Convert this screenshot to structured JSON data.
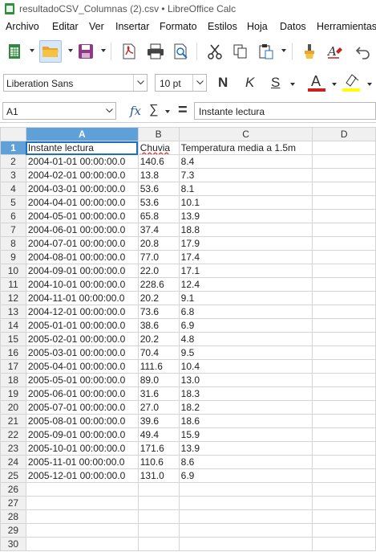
{
  "window": {
    "title": "resultadoCSV_Columnas (2).csv • LibreOffice Calc"
  },
  "menu": [
    "Archivo",
    "Editar",
    "Ver",
    "Insertar",
    "Formato",
    "Estilos",
    "Hoja",
    "Datos",
    "Herramientas"
  ],
  "toolbar": {
    "icons": [
      "new-spreadsheet-icon",
      "open-folder-icon",
      "save-icon",
      "export-pdf-icon",
      "print-icon",
      "print-preview-icon",
      "cut-icon",
      "copy-icon",
      "paste-icon",
      "clone-formatting-icon",
      "clear-formatting-icon",
      "undo-icon"
    ]
  },
  "format": {
    "font_name": "Liberation Sans",
    "font_size": "10 pt",
    "bold": "N",
    "italic": "K",
    "underline": "S",
    "font_color_label": "A",
    "font_color": "#c9211e",
    "highlight_color": "#ffff00"
  },
  "formula_bar": {
    "name_box": "A1",
    "content": "Instante lectura"
  },
  "columns": [
    "A",
    "B",
    "C",
    "D"
  ],
  "row_numbers": [
    "1",
    "2",
    "3",
    "4",
    "5",
    "6",
    "7",
    "8",
    "9",
    "10",
    "11",
    "12",
    "13",
    "14",
    "15",
    "16",
    "17",
    "18",
    "19",
    "20",
    "21",
    "22",
    "23",
    "24",
    "25",
    "26",
    "27",
    "28",
    "29",
    "30"
  ],
  "cells": [
    [
      "Instante lectura",
      "Chuvia",
      "Temperatura media a 1.5m"
    ],
    [
      "2004-01-01 00:00:00.0",
      "140.6",
      "8.4"
    ],
    [
      "2004-02-01 00:00:00.0",
      "13.8",
      "7.3"
    ],
    [
      "2004-03-01 00:00:00.0",
      "53.6",
      "8.1"
    ],
    [
      "2004-04-01 00:00:00.0",
      "53.6",
      "10.1"
    ],
    [
      "2004-05-01 00:00:00.0",
      "65.8",
      "13.9"
    ],
    [
      "2004-06-01 00:00:00.0",
      "37.4",
      "18.8"
    ],
    [
      "2004-07-01 00:00:00.0",
      "20.8",
      "17.9"
    ],
    [
      "2004-08-01 00:00:00.0",
      "77.0",
      "17.4"
    ],
    [
      "2004-09-01 00:00:00.0",
      "22.0",
      "17.1"
    ],
    [
      "2004-10-01 00:00:00.0",
      "228.6",
      "12.4"
    ],
    [
      "2004-11-01 00:00:00.0",
      "20.2",
      "9.1"
    ],
    [
      "2004-12-01 00:00:00.0",
      "73.6",
      "6.8"
    ],
    [
      "2005-01-01 00:00:00.0",
      "38.6",
      "6.9"
    ],
    [
      "2005-02-01 00:00:00.0",
      "20.2",
      "4.8"
    ],
    [
      "2005-03-01 00:00:00.0",
      "70.4",
      "9.5"
    ],
    [
      "2005-04-01 00:00:00.0",
      "111.6",
      "10.4"
    ],
    [
      "2005-05-01 00:00:00.0",
      "89.0",
      "13.0"
    ],
    [
      "2005-06-01 00:00:00.0",
      "31.6",
      "18.3"
    ],
    [
      "2005-07-01 00:00:00.0",
      "27.0",
      "18.2"
    ],
    [
      "2005-08-01 00:00:00.0",
      "39.6",
      "18.6"
    ],
    [
      "2005-09-01 00:00:00.0",
      "49.4",
      "15.9"
    ],
    [
      "2005-10-01 00:00:00.0",
      "171.6",
      "13.9"
    ],
    [
      "2005-11-01 00:00:00.0",
      "110.6",
      "8.6"
    ],
    [
      "2005-12-01 00:00:00.0",
      "131.0",
      "6.9"
    ]
  ]
}
